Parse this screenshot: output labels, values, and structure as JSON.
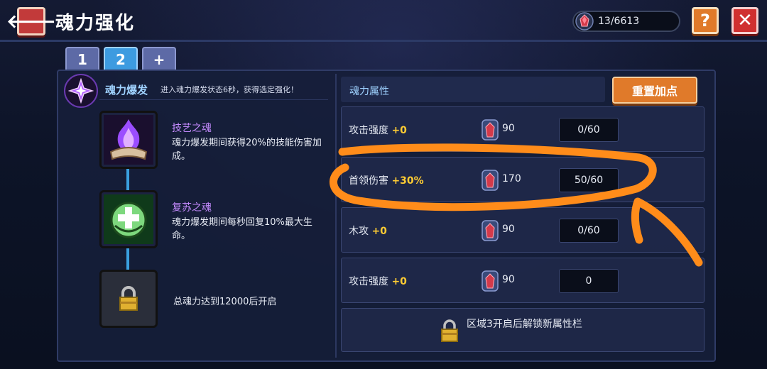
{
  "header": {
    "title": "魂力强化",
    "currency_value": "13/6613",
    "help_label": "?",
    "close_label": "✕",
    "back_label": "🡐"
  },
  "tabs": [
    {
      "label": "1",
      "active": false
    },
    {
      "label": "2",
      "active": true
    },
    {
      "label": "+",
      "active": false
    }
  ],
  "burst": {
    "title": "魂力爆发",
    "description": "进入魂力爆发状态6秒，获得选定强化！"
  },
  "souls": [
    {
      "title": "技艺之魂",
      "description": "魂力爆发期间获得20%的技能伤害加成。",
      "icon": "purple-flame-icon"
    },
    {
      "title": "复苏之魂",
      "description": "魂力爆发期间每秒回复10%最大生命。",
      "icon": "green-heal-icon"
    }
  ],
  "locked_soul_text": "总魂力达到12000后开启",
  "attributes": {
    "header_title": "魂力属性",
    "reset_label": "重置加点",
    "rows": [
      {
        "name": "攻击强度",
        "bonus": "+0",
        "cost": "90",
        "value": "0/60"
      },
      {
        "name": "首领伤害",
        "bonus": "+30%",
        "cost": "170",
        "value": "50/60"
      },
      {
        "name": "木攻",
        "bonus": "+0",
        "cost": "90",
        "value": "0/60"
      },
      {
        "name": "攻击强度",
        "bonus": "+0",
        "cost": "90",
        "value": "0"
      }
    ],
    "locked_slot_text": "区域3开启后解锁新属性栏"
  },
  "colors": {
    "accent_orange": "#e07a2a",
    "bonus_yellow": "#ffcc33",
    "tab_active": "#3d9be0",
    "annotation": "#ff8c1a"
  }
}
